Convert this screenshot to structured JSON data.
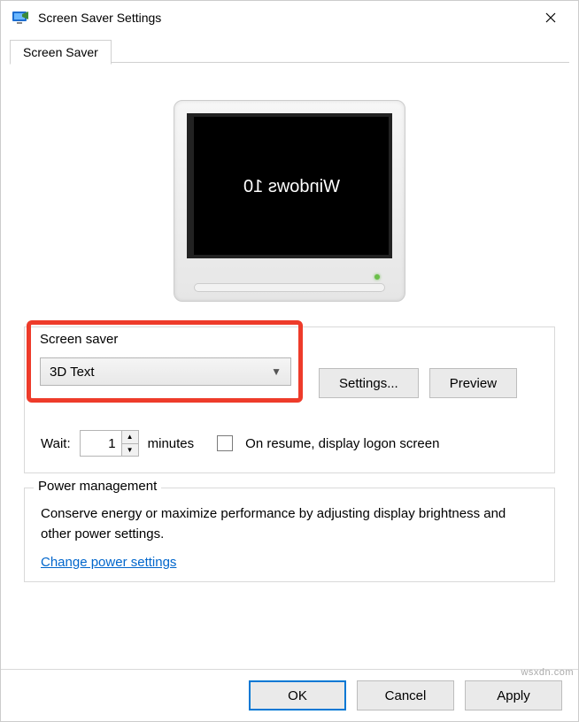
{
  "window": {
    "title": "Screen Saver Settings"
  },
  "tabs": {
    "active": "Screen Saver"
  },
  "preview": {
    "text": "Windows",
    "sub": " 10"
  },
  "screenSaver": {
    "group_label": "Screen saver",
    "selected": "3D Text",
    "settings_btn": "Settings...",
    "preview_btn": "Preview",
    "wait_label": "Wait:",
    "wait_value": "1",
    "wait_unit": "minutes",
    "resume_label": "On resume, display logon screen"
  },
  "power": {
    "group_label": "Power management",
    "text": "Conserve energy or maximize performance by adjusting display brightness and other power settings.",
    "link": "Change power settings"
  },
  "footer": {
    "ok": "OK",
    "cancel": "Cancel",
    "apply": "Apply"
  },
  "watermark": "wsxdn.com"
}
